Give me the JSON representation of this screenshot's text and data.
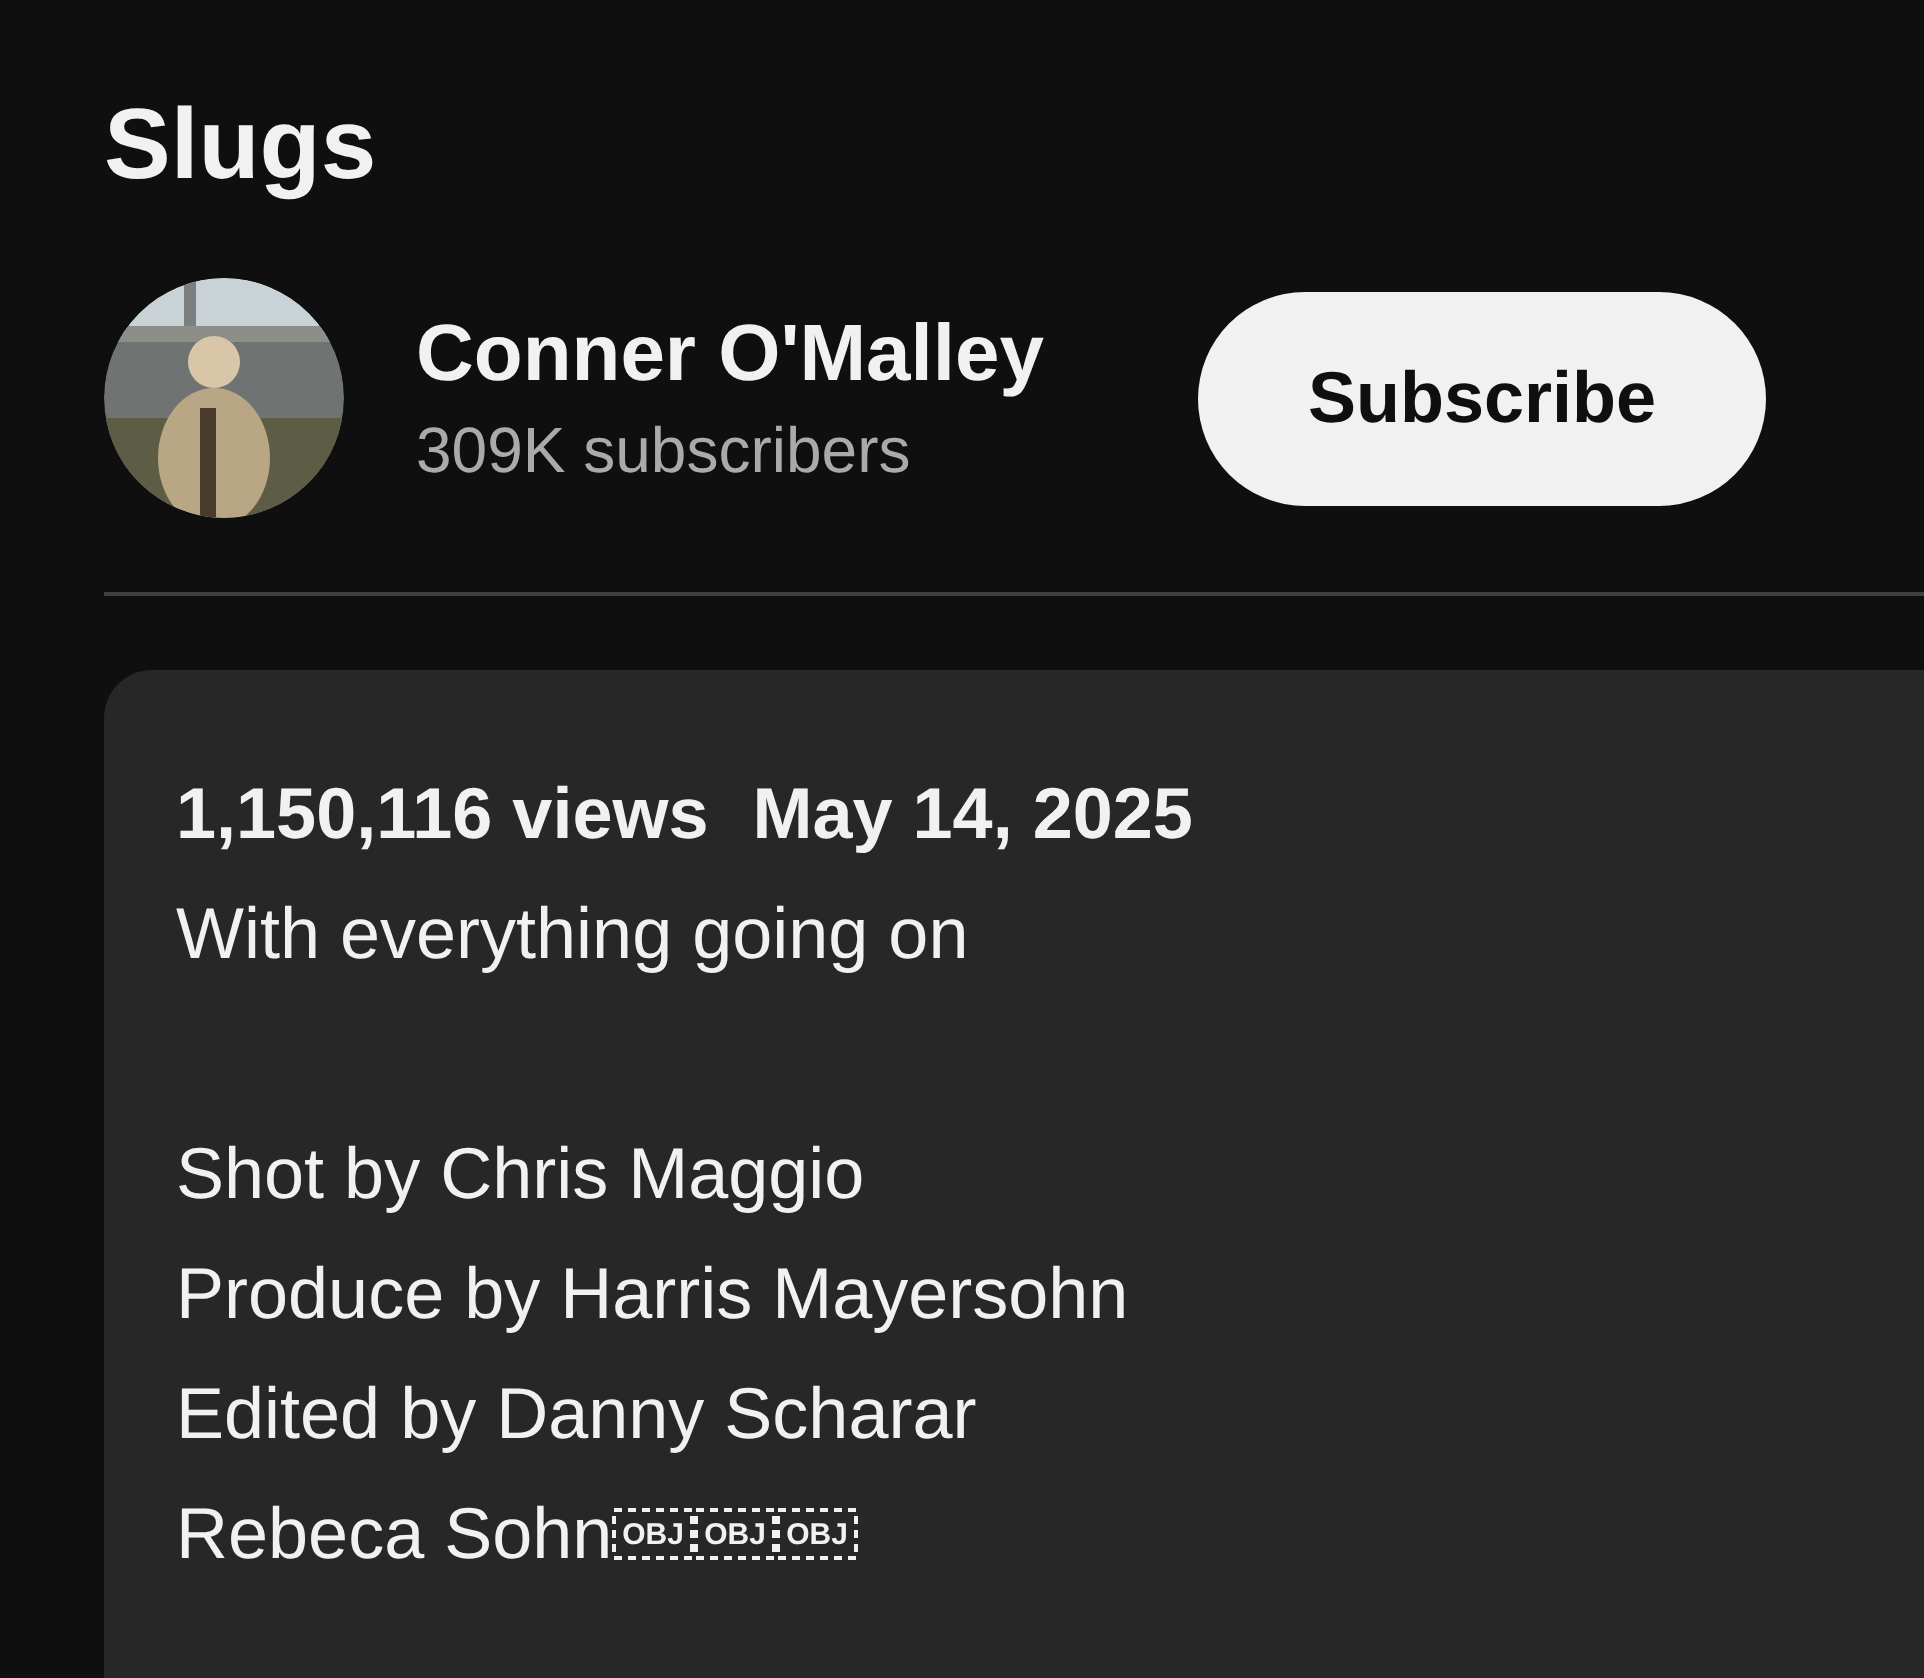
{
  "video": {
    "title": "Slugs"
  },
  "channel": {
    "name": "Conner O'Malley",
    "subscribers": "309K subscribers"
  },
  "subscribe_button": {
    "label": "Subscribe"
  },
  "description": {
    "views": "1,150,116 views",
    "date": "May 14, 2025",
    "paragraphs": [
      [
        "With everything going on"
      ],
      [
        "Shot by Chris Maggio",
        "Produce by Harris Mayersohn",
        "Edited by Danny Scharar",
        {
          "text": "Rebeca Sohn",
          "embedded": [
            {
              "kind": "object",
              "label": "OBJ"
            },
            {
              "kind": "object",
              "label": "OBJ"
            },
            {
              "kind": "object",
              "label": "OBJ"
            }
          ]
        }
      ]
    ]
  }
}
